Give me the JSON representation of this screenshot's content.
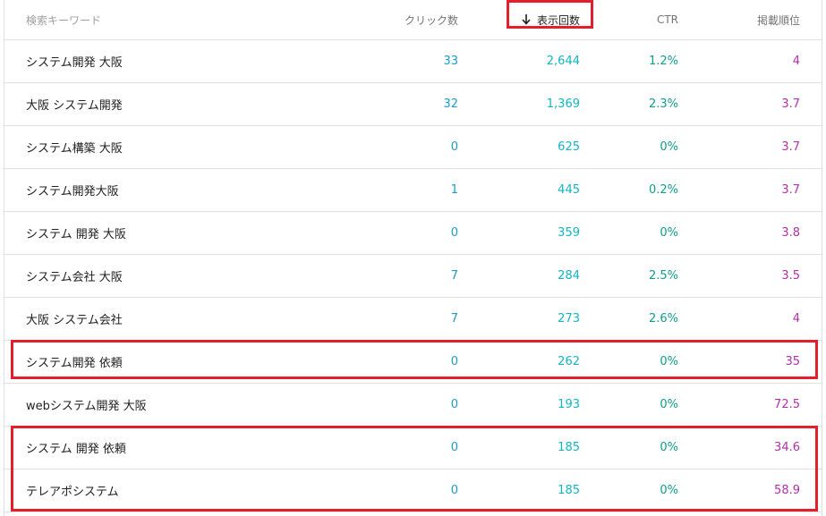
{
  "header": {
    "keyword": "検索キーワード",
    "clicks": "クリック数",
    "impressions": "表示回数",
    "ctr": "CTR",
    "position": "掲載順位",
    "sort_icon": "arrow-down-icon"
  },
  "rows": [
    {
      "keyword": "システム開発 大阪",
      "clicks": "33",
      "impressions": "2,644",
      "ctr": "1.2%",
      "position": "4"
    },
    {
      "keyword": "大阪 システム開発",
      "clicks": "32",
      "impressions": "1,369",
      "ctr": "2.3%",
      "position": "3.7"
    },
    {
      "keyword": "システム構築 大阪",
      "clicks": "0",
      "impressions": "625",
      "ctr": "0%",
      "position": "3.7"
    },
    {
      "keyword": "システム開発大阪",
      "clicks": "1",
      "impressions": "445",
      "ctr": "0.2%",
      "position": "3.7"
    },
    {
      "keyword": "システム 開発 大阪",
      "clicks": "0",
      "impressions": "359",
      "ctr": "0%",
      "position": "3.8"
    },
    {
      "keyword": "システム会社 大阪",
      "clicks": "7",
      "impressions": "284",
      "ctr": "2.5%",
      "position": "3.5"
    },
    {
      "keyword": "大阪 システム会社",
      "clicks": "7",
      "impressions": "273",
      "ctr": "2.6%",
      "position": "4"
    },
    {
      "keyword": "システム開発 依頼",
      "clicks": "0",
      "impressions": "262",
      "ctr": "0%",
      "position": "35"
    },
    {
      "keyword": "webシステム開発 大阪",
      "clicks": "0",
      "impressions": "193",
      "ctr": "0%",
      "position": "72.5"
    },
    {
      "keyword": "システム 開発 依頼",
      "clicks": "0",
      "impressions": "185",
      "ctr": "0%",
      "position": "34.6"
    },
    {
      "keyword": "テレアポシステム",
      "clicks": "0",
      "impressions": "185",
      "ctr": "0%",
      "position": "58.9"
    }
  ],
  "colors": {
    "clicks": "#1a9bc9",
    "impressions": "#12b5c5",
    "ctr": "#139c8c",
    "position": "#b030a8",
    "highlight": "#e41e2a"
  }
}
